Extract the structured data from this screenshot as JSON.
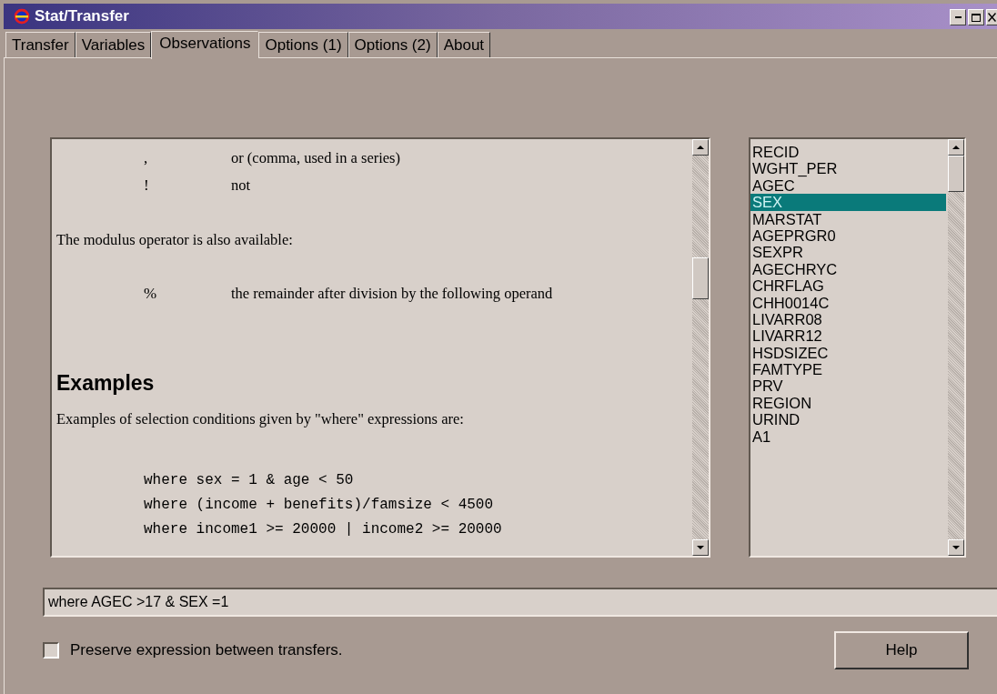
{
  "window": {
    "title": "Stat/Transfer"
  },
  "tabs": [
    {
      "label": "Transfer",
      "selected": false
    },
    {
      "label": "Variables",
      "selected": false
    },
    {
      "label": "Observations",
      "selected": true
    },
    {
      "label": "Options (1)",
      "selected": false
    },
    {
      "label": "Options (2)",
      "selected": false
    },
    {
      "label": "About",
      "selected": false
    }
  ],
  "help_text": [
    {
      "kind": "operator",
      "symbol": ",",
      "meaning": "or (comma, used in a series)"
    },
    {
      "kind": "operator",
      "symbol": "!",
      "meaning": "not"
    },
    {
      "kind": "paragraph",
      "text": "The modulus operator is also available:"
    },
    {
      "kind": "operator",
      "symbol": "%",
      "meaning": "the remainder after division by the following operand"
    },
    {
      "kind": "heading",
      "text": "Examples"
    },
    {
      "kind": "paragraph",
      "text": "Examples of selection  conditions given by \"where\" expressions are:"
    },
    {
      "kind": "code",
      "lines": [
        "where sex = 1 & age < 50",
        "where (income + benefits)/famsize < 4500",
        "where income1 >= 20000 | income2 >= 20000"
      ]
    }
  ],
  "variables": [
    {
      "name": "RECID",
      "selected": false
    },
    {
      "name": "WGHT_PER",
      "selected": false
    },
    {
      "name": "AGEC",
      "selected": false
    },
    {
      "name": "SEX",
      "selected": true
    },
    {
      "name": "MARSTAT",
      "selected": false
    },
    {
      "name": "AGEPRGR0",
      "selected": false
    },
    {
      "name": "SEXPR",
      "selected": false
    },
    {
      "name": "AGECHRYC",
      "selected": false
    },
    {
      "name": "CHRFLAG",
      "selected": false
    },
    {
      "name": "CHH0014C",
      "selected": false
    },
    {
      "name": "LIVARR08",
      "selected": false
    },
    {
      "name": "LIVARR12",
      "selected": false
    },
    {
      "name": "HSDSIZEC",
      "selected": false
    },
    {
      "name": "FAMTYPE",
      "selected": false
    },
    {
      "name": "PRV",
      "selected": false
    },
    {
      "name": "REGION",
      "selected": false
    },
    {
      "name": "URIND",
      "selected": false
    },
    {
      "name": "A1",
      "selected": false
    }
  ],
  "expression": {
    "value": "where AGEC >17 & SEX =1"
  },
  "preserve": {
    "label": "Preserve expression between transfers.",
    "checked": false
  },
  "buttons": [
    {
      "label": "Help"
    }
  ]
}
